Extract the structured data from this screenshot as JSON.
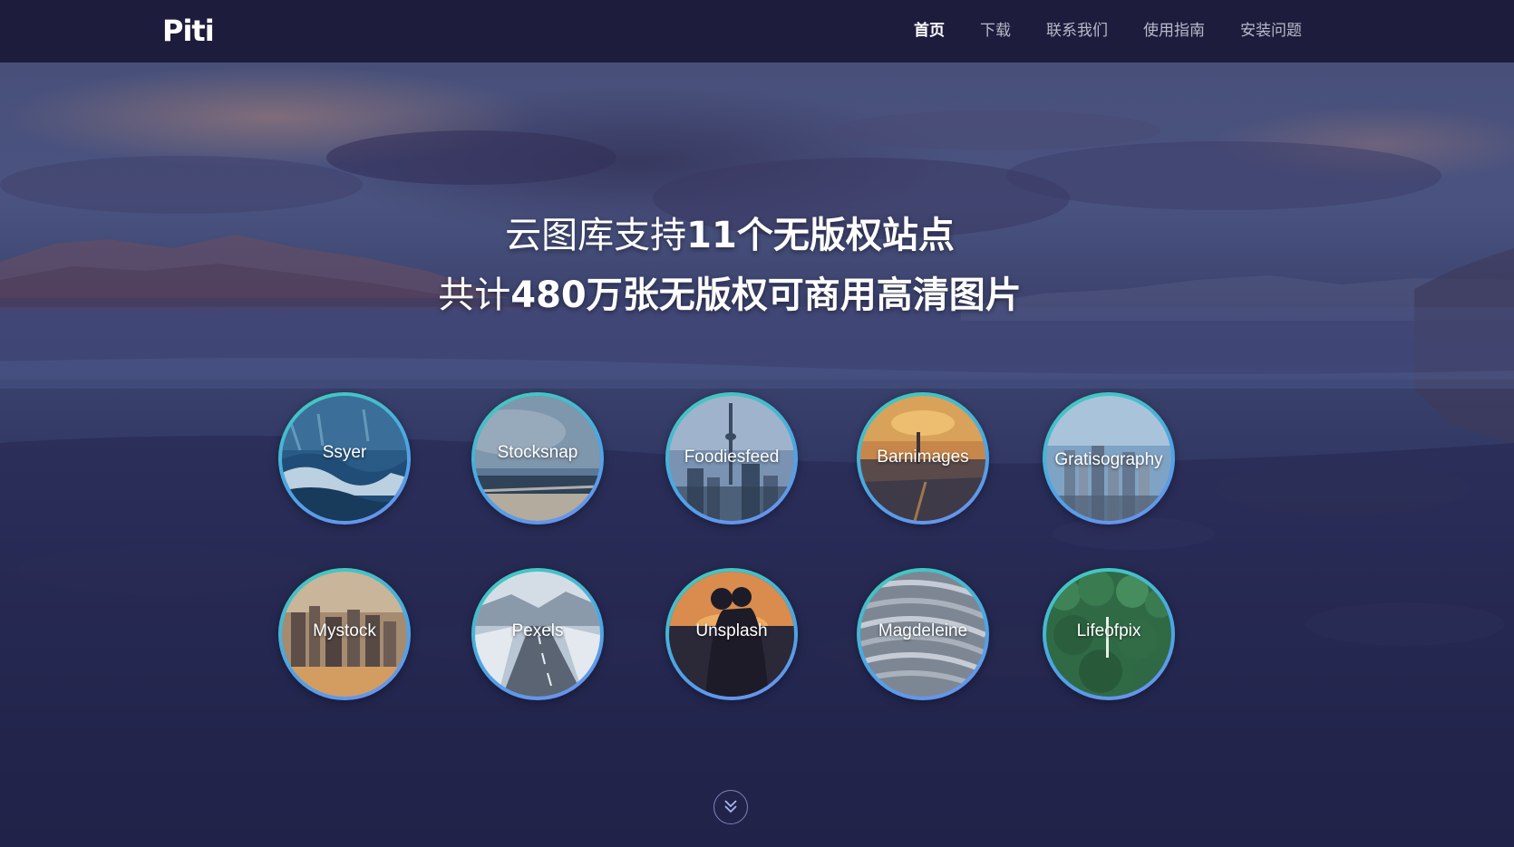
{
  "app": {
    "logo": "Piti"
  },
  "nav": {
    "items": [
      {
        "label": "首页",
        "active": true
      },
      {
        "label": "下载",
        "active": false
      },
      {
        "label": "联系我们",
        "active": false
      },
      {
        "label": "使用指南",
        "active": false
      },
      {
        "label": "安装问题",
        "active": false
      }
    ]
  },
  "headline": {
    "line1_light": "云图库支持",
    "line1_bold": "11个无版权站点",
    "line2_light": "共计",
    "line2_bold": "480万张无版权可商用高清图片"
  },
  "sites": [
    {
      "name": "Ssyer",
      "theme": "ocean-wave"
    },
    {
      "name": "Stocksnap",
      "theme": "cloudy-sea"
    },
    {
      "name": "Foodiesfeed",
      "theme": "city-tower"
    },
    {
      "name": "Barnimages",
      "theme": "sunset-city"
    },
    {
      "name": "Gratisography",
      "theme": "city-skyline"
    },
    {
      "name": "Mystock",
      "theme": "city-sunset"
    },
    {
      "name": "Pexels",
      "theme": "snowy-road"
    },
    {
      "name": "Unsplash",
      "theme": "couple-sunset"
    },
    {
      "name": "Magdeleine",
      "theme": "abstract-waves"
    },
    {
      "name": "Lifeofpix",
      "theme": "forest"
    }
  ],
  "scroll": {
    "icon": "double-chevron-down-icon"
  },
  "colors": {
    "navbar_bg": "#1d1c3d",
    "nav_active": "#ffffff",
    "nav_inactive": "#b9b9c9",
    "ring_start": "#3fd0b8",
    "ring_end": "#6d8ff0"
  }
}
